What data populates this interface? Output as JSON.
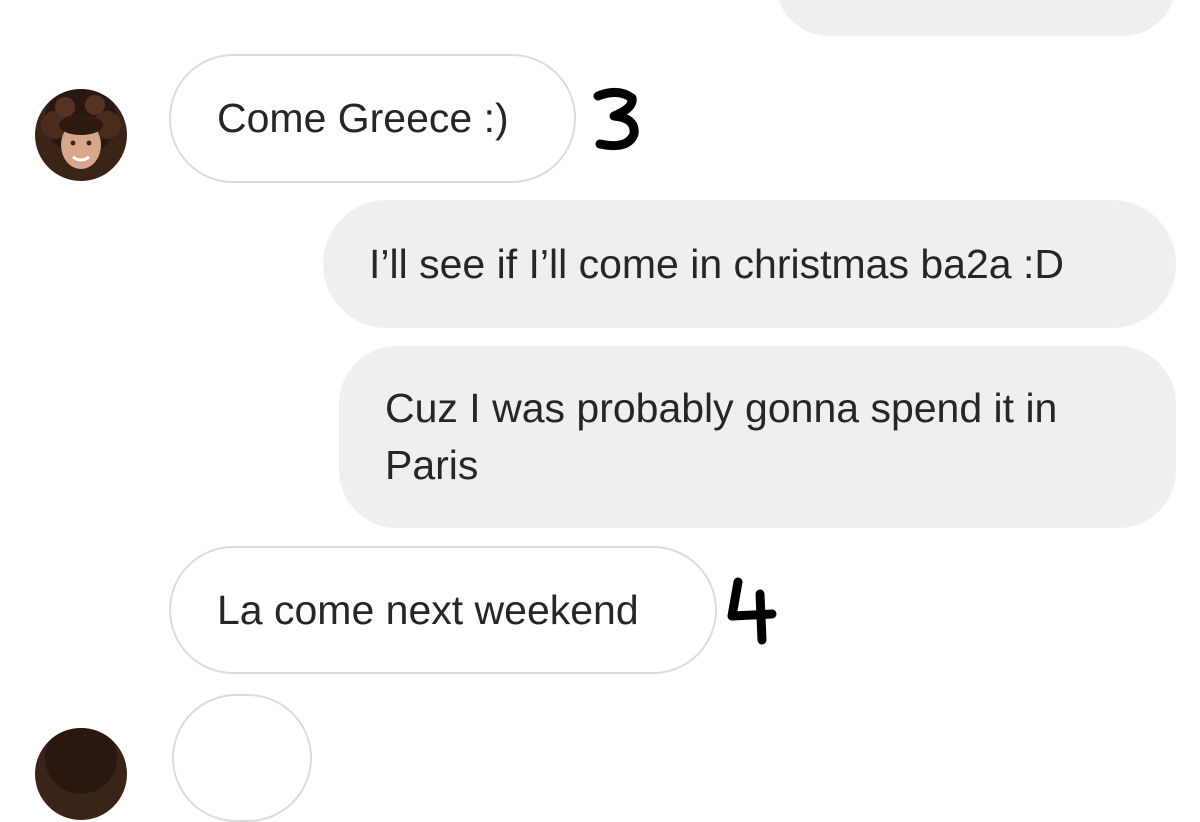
{
  "conversation": {
    "messages": [
      {
        "sender": "them",
        "text": "Come Greece :)",
        "annotation": "3"
      },
      {
        "sender": "me",
        "text": "I’ll see if I’ll come in christmas ba2a :D"
      },
      {
        "sender": "me",
        "text": "Cuz I was probably gonna spend it in Paris"
      },
      {
        "sender": "them",
        "text": "La come next weekend",
        "annotation": "4"
      }
    ]
  },
  "colors": {
    "incoming_bg": "#ffffff",
    "incoming_border": "#dbdbdb",
    "outgoing_bg": "#efefef",
    "text": "#262626",
    "annotation_ink": "#000000"
  }
}
